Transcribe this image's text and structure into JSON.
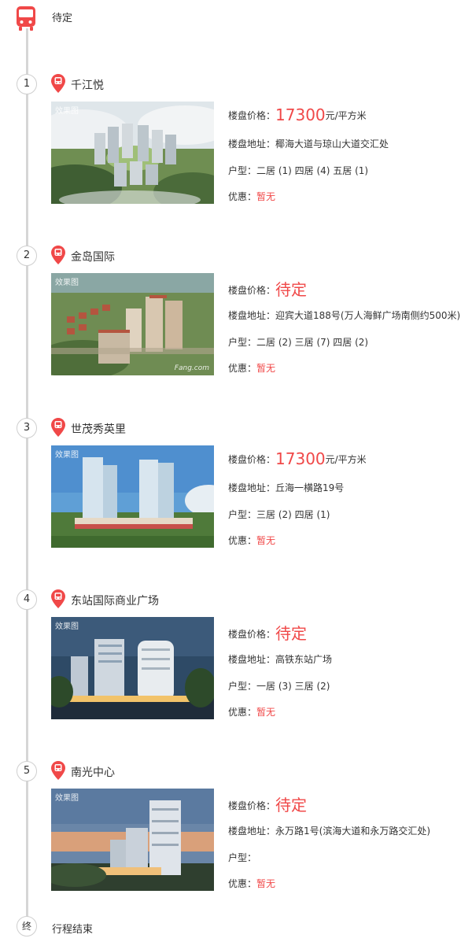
{
  "start": {
    "label": "待定"
  },
  "end": {
    "marker": "终",
    "label": "行程结束"
  },
  "photo_tag": "效果图",
  "labels": {
    "price": "楼盘价格：",
    "address": "楼盘地址：",
    "layout": "户型：",
    "promo": "优惠：",
    "unit": "元/平方米"
  },
  "items": [
    {
      "num": "1",
      "name": "千江悦",
      "price": "17300",
      "address": "椰海大道与琼山大道交汇处",
      "layout": "二居 (1) 四居 (4) 五居 (1)",
      "promo": "暂无"
    },
    {
      "num": "2",
      "name": "金岛国际",
      "price": "待定",
      "address": "迎宾大道188号(万人海鲜广场南侧约500米)",
      "layout": "二居 (2) 三居 (7) 四居 (2)",
      "promo": "暂无",
      "watermark": "Fang.com"
    },
    {
      "num": "3",
      "name": "世茂秀英里",
      "price": "17300",
      "address": "丘海一横路19号",
      "layout": "三居 (2) 四居 (1)",
      "promo": "暂无"
    },
    {
      "num": "4",
      "name": "东站国际商业广场",
      "price": "待定",
      "address": "高铁东站广场",
      "layout": "一居 (3) 三居 (2)",
      "promo": "暂无"
    },
    {
      "num": "5",
      "name": "南光中心",
      "price": "待定",
      "address": "永万路1号(滨海大道和永万路交汇处)",
      "layout": "",
      "promo": "暂无"
    }
  ],
  "colors": {
    "accent": "#f04848",
    "timeline": "#d6d6d6"
  },
  "icons": {
    "start": "bus-icon",
    "item": "bus-pin-icon"
  }
}
